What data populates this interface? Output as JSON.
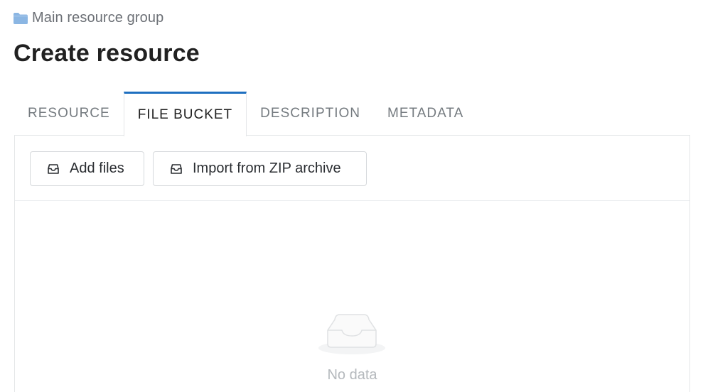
{
  "breadcrumb": {
    "icon": "folder-icon",
    "icon_color": "#8bb6e3",
    "label": "Main resource group"
  },
  "page": {
    "title": "Create resource"
  },
  "tabs": [
    {
      "label": "RESOURCE",
      "active": false
    },
    {
      "label": "FILE BUCKET",
      "active": true
    },
    {
      "label": "DESCRIPTION",
      "active": false
    },
    {
      "label": "METADATA",
      "active": false
    }
  ],
  "toolbar": {
    "add_files": {
      "label": "Add files",
      "icon": "inbox-icon"
    },
    "import_zip": {
      "label": "Import from ZIP archive",
      "icon": "inbox-icon"
    }
  },
  "empty_state": {
    "icon": "empty-inbox-icon",
    "text": "No data"
  },
  "colors": {
    "accent": "#1e6fc0",
    "muted_text": "#757b80",
    "border": "#e4e6e8"
  }
}
